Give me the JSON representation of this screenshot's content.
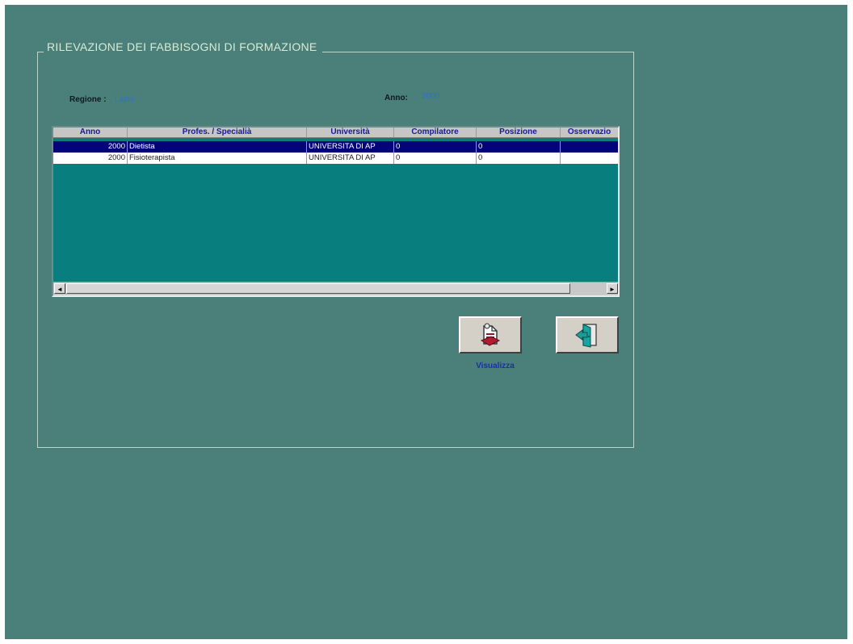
{
  "form": {
    "title": "RILEVAZIONE DEI FABBISOGNI DI FORMAZIONE",
    "regione_label": "Regione :",
    "regione_value": "Lazio",
    "anno_label": "Anno:",
    "anno_value": "2000"
  },
  "grid": {
    "columns": [
      "Anno",
      "Profes. / Specialià",
      "Università",
      "Compilatore",
      "Posizione",
      "Osservazio"
    ],
    "rows": [
      {
        "anno": "2000",
        "profes": "Dietista",
        "universita": "UNIVERSITA DI AP",
        "compilatore": "0",
        "posizione": "0",
        "osservazioni": "",
        "selected": true
      },
      {
        "anno": "2000",
        "profes": "Fisioterapista",
        "universita": "UNIVERSITA DI AP",
        "compilatore": "0",
        "posizione": "0",
        "osservazioni": "",
        "selected": false
      }
    ],
    "scroll_left": "◄",
    "scroll_right": "►"
  },
  "buttons": {
    "visualizza_label": "Visualizza",
    "visualizza_icon": "report-view-icon",
    "exit_icon": "exit-door-icon"
  },
  "colors": {
    "background": "#4a7f7a",
    "grid_background": "#087e7f",
    "selected_row": "#04047a",
    "header_text": "#1717a8",
    "value_text": "#2f6de0"
  }
}
